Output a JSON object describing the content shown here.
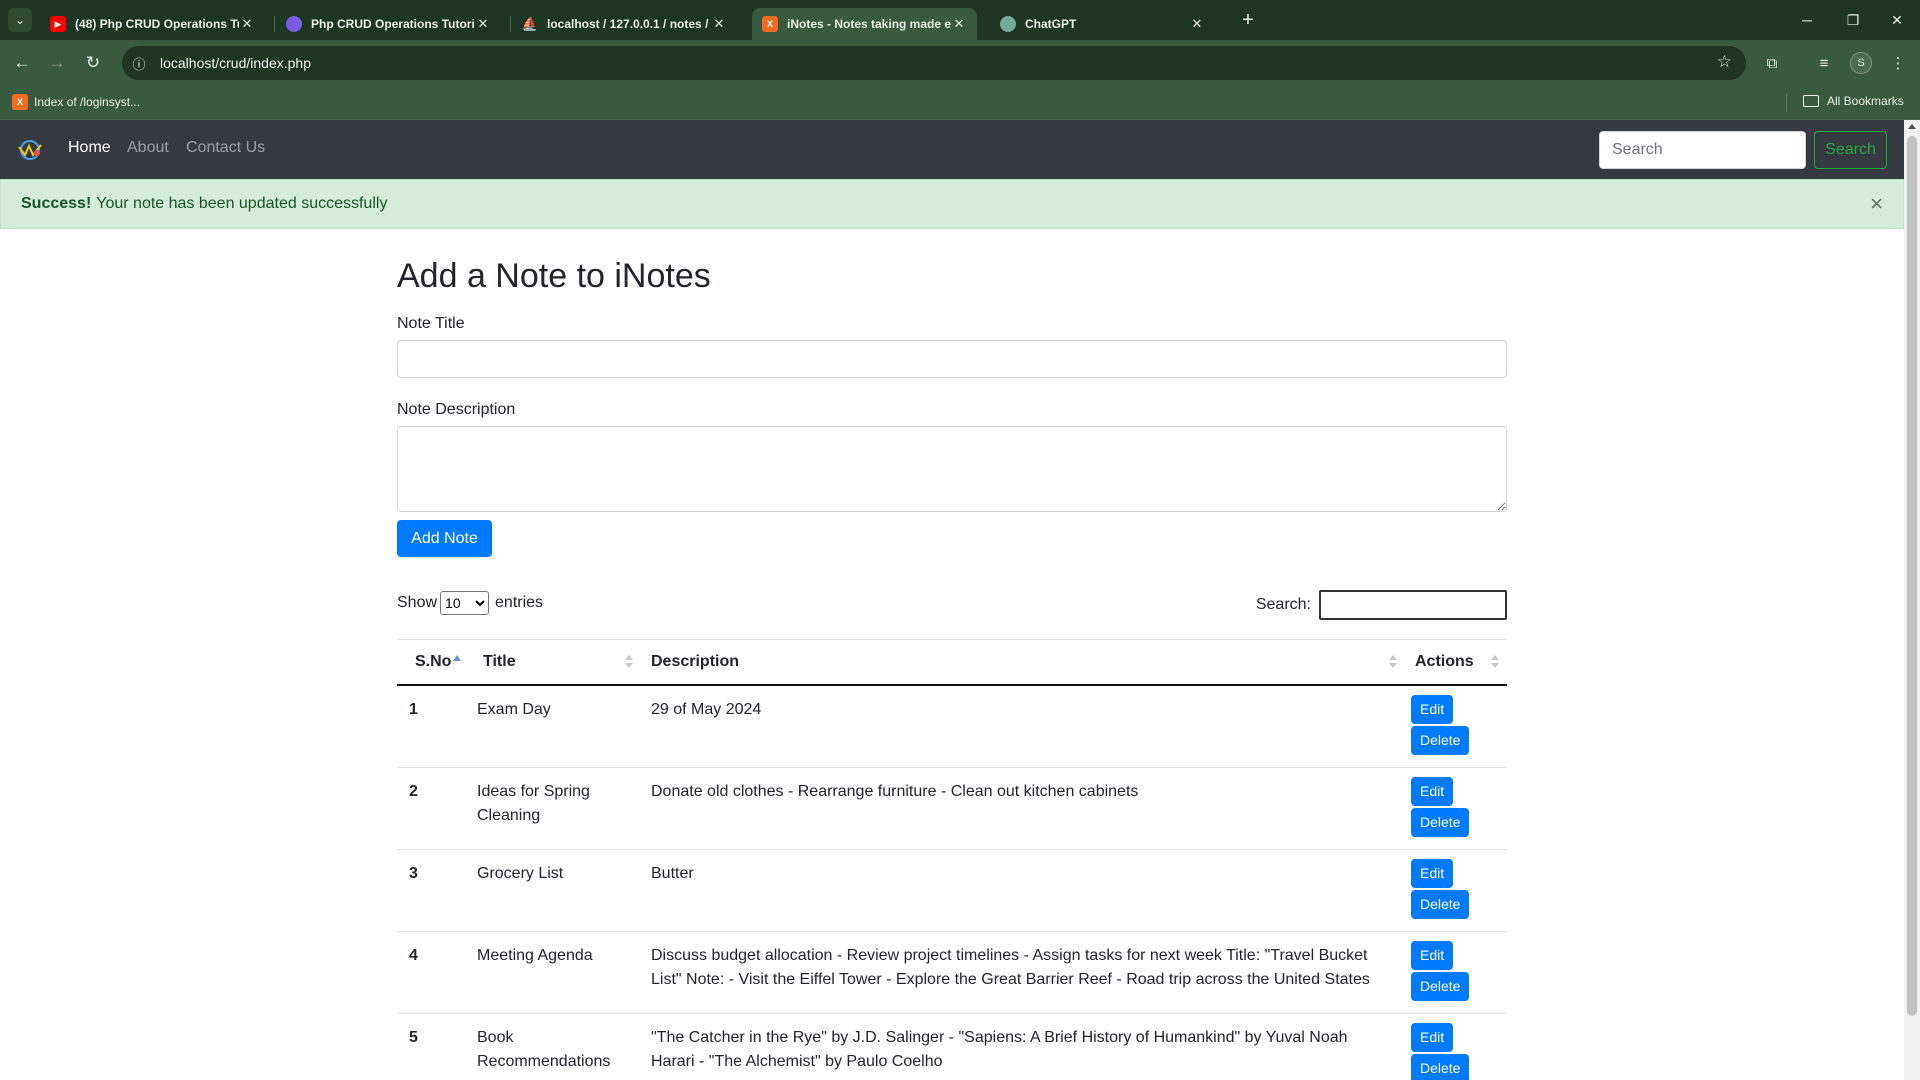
{
  "browser": {
    "tabs": [
      {
        "label": "(48) Php CRUD Operations Tut",
        "favicon": "youtube-icon",
        "active": false
      },
      {
        "label": "Php CRUD Operations Tutorial",
        "favicon": "globe-icon",
        "active": false
      },
      {
        "label": "localhost / 127.0.0.1 / notes / n",
        "favicon": "phpmyadmin-icon",
        "active": false
      },
      {
        "label": "iNotes - Notes taking made ea",
        "favicon": "xampp-icon",
        "active": true
      },
      {
        "label": "ChatGPT",
        "favicon": "chatgpt-icon",
        "active": false
      }
    ],
    "url": "localhost/crud/index.php",
    "bookmark": "Index of /loginsyst...",
    "all_bookmarks": "All Bookmarks",
    "profile_initial": "S"
  },
  "navbar": {
    "links": [
      "Home",
      "About",
      "Contact Us"
    ],
    "search_placeholder": "Search",
    "search_button": "Search"
  },
  "alert": {
    "strong": "Success!",
    "message": "Your note has been updated successfully",
    "close": "×"
  },
  "form": {
    "heading": "Add a Note to iNotes",
    "title_label": "Note Title",
    "title_value": "",
    "description_label": "Note Description",
    "description_value": "",
    "submit": "Add Note"
  },
  "datatable": {
    "show": "Show",
    "entries": "entries",
    "length_selected": "10",
    "search_label": "Search:",
    "columns": [
      "S.No",
      "Title",
      "Description",
      "Actions"
    ],
    "rows": [
      {
        "sno": "1",
        "title": "Exam Day",
        "description": "29 of May 2024"
      },
      {
        "sno": "2",
        "title": "Ideas for Spring Cleaning",
        "description": "Donate old clothes - Rearrange furniture - Clean out kitchen cabinets"
      },
      {
        "sno": "3",
        "title": "Grocery List",
        "description": "Butter"
      },
      {
        "sno": "4",
        "title": "Meeting Agenda",
        "description": "Discuss budget allocation - Review project timelines - Assign tasks for next week Title: \"Travel Bucket List\" Note: - Visit the Eiffel Tower - Explore the Great Barrier Reef - Road trip across the United States"
      },
      {
        "sno": "5",
        "title": "Book Recommendations",
        "description": "\"The Catcher in the Rye\" by J.D. Salinger - \"Sapiens: A Brief History of Humankind\" by Yuval Noah Harari - \"The Alchemist\" by Paulo Coelho"
      }
    ],
    "edit_label": "Edit",
    "delete_label": "Delete"
  },
  "colors": {
    "navbar": "#343a40",
    "primary": "#007bff",
    "success_bg": "#d4edda",
    "success_text": "#155724",
    "search_btn": "#28a745",
    "chrome": "#385a3e"
  }
}
